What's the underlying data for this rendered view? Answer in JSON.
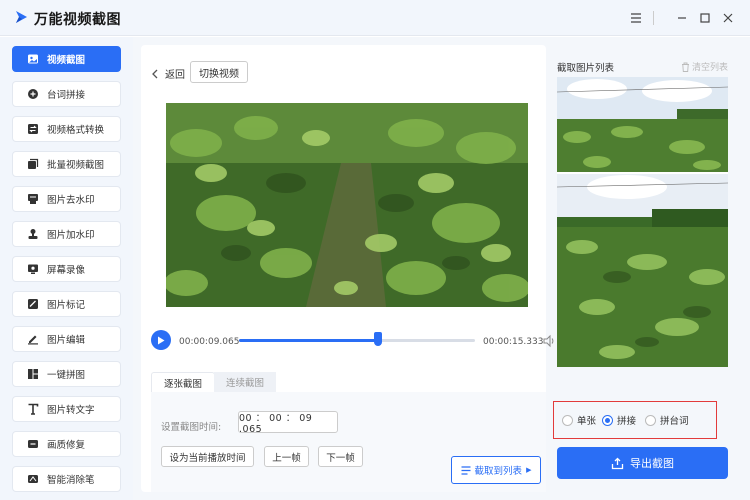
{
  "app": {
    "title": "万能视频截图"
  },
  "window_controls": [
    "menu-icon",
    "minimize-icon",
    "maximize-icon",
    "close-icon"
  ],
  "sidebar": {
    "items": [
      {
        "label": "视频截图",
        "icon": "image-icon",
        "active": true
      },
      {
        "label": "台词拼接",
        "icon": "plus-circle-icon",
        "active": false
      },
      {
        "label": "视频格式转换",
        "icon": "convert-icon",
        "active": false
      },
      {
        "label": "批量视频截图",
        "icon": "batch-icon",
        "active": false
      },
      {
        "label": "图片去水印",
        "icon": "eraser-icon",
        "active": false
      },
      {
        "label": "图片加水印",
        "icon": "stamp-icon",
        "active": false
      },
      {
        "label": "屏幕录像",
        "icon": "record-icon",
        "active": false
      },
      {
        "label": "图片标记",
        "icon": "mark-icon",
        "active": false
      },
      {
        "label": "图片编辑",
        "icon": "edit-icon",
        "active": false
      },
      {
        "label": "一键拼图",
        "icon": "puzzle-icon",
        "active": false
      },
      {
        "label": "图片转文字",
        "icon": "text-icon",
        "active": false
      },
      {
        "label": "画质修复",
        "icon": "repair-icon",
        "active": false
      },
      {
        "label": "智能消除笔",
        "icon": "brush-icon",
        "active": false
      }
    ]
  },
  "toolbar": {
    "back_label": "返回",
    "switch_video_label": "切换视频"
  },
  "player": {
    "current_time": "00:00:09.065",
    "total_time": "00:00:15.333",
    "progress": 0.59
  },
  "tabs": [
    {
      "label": "逐张截图",
      "active": true
    },
    {
      "label": "连续截图",
      "active": false
    }
  ],
  "capture_settings": {
    "time_label": "设置截图时间:",
    "time_value": "00 ： 00 ： 09 .065",
    "set_current_label": "设为当前播放时间",
    "prev_frame_label": "上一帧",
    "next_frame_label": "下一帧",
    "capture_to_list_label": "截取到列表"
  },
  "list_panel": {
    "title": "截取图片列表",
    "clear_label": "清空列表"
  },
  "output_options": {
    "options": [
      {
        "label": "单张",
        "selected": false
      },
      {
        "label": "拼接",
        "selected": true
      },
      {
        "label": "拼台词",
        "selected": false
      }
    ],
    "highlight_color": "#e23b3b"
  },
  "export": {
    "label": "导出截图"
  },
  "colors": {
    "accent": "#2a6ef5"
  }
}
